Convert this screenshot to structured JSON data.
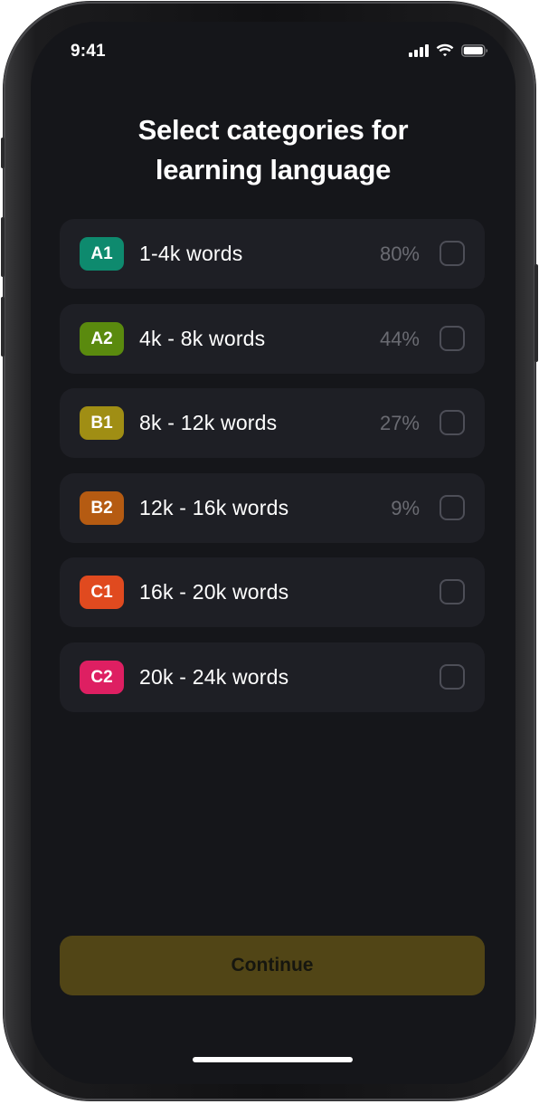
{
  "status_bar": {
    "time": "9:41",
    "icons": [
      "cellular-signal-icon",
      "wifi-icon",
      "battery-icon"
    ]
  },
  "title": {
    "line1": "Select categories for",
    "line2": "learning language"
  },
  "categories": [
    {
      "level": "A1",
      "label": "1-4k words",
      "percent": "80%",
      "color": "#0e8a6e",
      "checked": false
    },
    {
      "level": "A2",
      "label": "4k - 8k words",
      "percent": "44%",
      "color": "#5a8a0e",
      "checked": false
    },
    {
      "level": "B1",
      "label": "8k - 12k words",
      "percent": "27%",
      "color": "#a08e14",
      "checked": false
    },
    {
      "level": "B2",
      "label": "12k - 16k words",
      "percent": "9%",
      "color": "#b55b12",
      "checked": false
    },
    {
      "level": "C1",
      "label": "16k - 20k words",
      "percent": "",
      "color": "#e04a1f",
      "checked": false
    },
    {
      "level": "C2",
      "label": "20k - 24k words",
      "percent": "",
      "color": "#de1f62",
      "checked": false
    }
  ],
  "continue_button": {
    "label": "Continue",
    "color": "#514516"
  },
  "colors": {
    "background": "#15161a",
    "card": "#1e1f25",
    "checkbox_border": "#4d4e57",
    "percent_text": "#6a6b72"
  }
}
